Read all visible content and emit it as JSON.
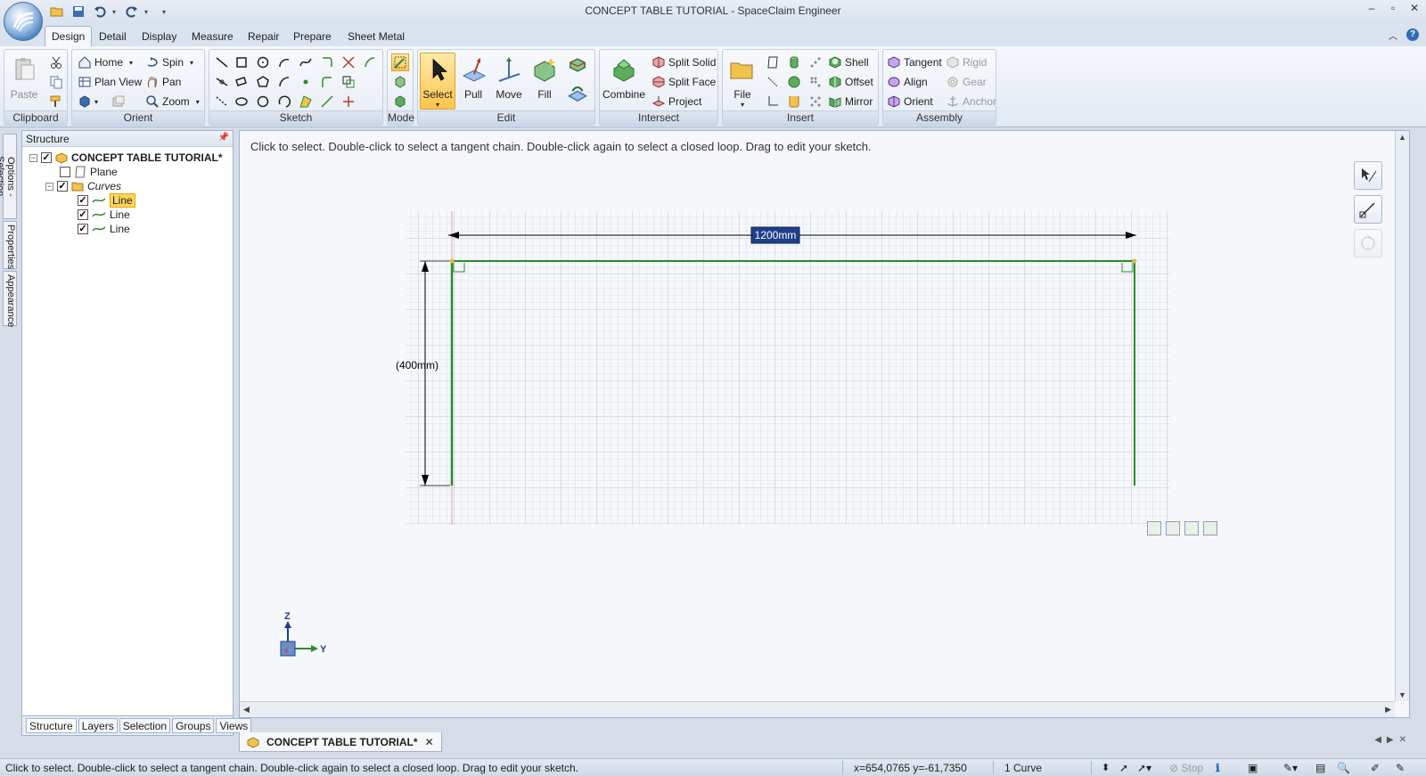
{
  "window": {
    "title": "CONCEPT TABLE TUTORIAL - SpaceClaim Engineer",
    "controls": [
      "minimize-icon",
      "maximize-icon",
      "close-icon"
    ]
  },
  "quick_access": [
    "open-icon",
    "save-icon",
    "undo-icon",
    "redo-icon",
    "customize-icon"
  ],
  "ribbon": {
    "tabs": [
      "Design",
      "Detail",
      "Display",
      "Measure",
      "Repair",
      "Prepare",
      "Sheet Metal"
    ],
    "active_tab": "Design",
    "groups": {
      "clipboard": {
        "label": "Clipboard",
        "paste": "Paste"
      },
      "orient": {
        "label": "Orient",
        "home": "Home",
        "spin": "Spin",
        "plan_view": "Plan View",
        "pan": "Pan",
        "zoom": "Zoom"
      },
      "sketch": {
        "label": "Sketch"
      },
      "mode": {
        "label": "Mode"
      },
      "edit": {
        "label": "Edit",
        "select": "Select",
        "pull": "Pull",
        "move": "Move",
        "fill": "Fill"
      },
      "intersect": {
        "label": "Intersect",
        "combine": "Combine",
        "split_solid": "Split Solid",
        "split_face": "Split Face",
        "project": "Project"
      },
      "insert": {
        "label": "Insert",
        "file": "File",
        "shell": "Shell",
        "offset": "Offset",
        "mirror": "Mirror"
      },
      "assembly": {
        "label": "Assembly",
        "tangent": "Tangent",
        "align": "Align",
        "orient": "Orient",
        "rigid": "Rigid",
        "gear": "Gear",
        "anchor": "Anchor"
      }
    }
  },
  "side_tabs": [
    "Options - Selection",
    "Properties",
    "Appearance"
  ],
  "structure": {
    "title": "Structure",
    "tree": {
      "root": "CONCEPT TABLE TUTORIAL*",
      "plane": "Plane",
      "curves": "Curves",
      "lines": [
        "Line",
        "Line",
        "Line"
      ]
    },
    "panel_tabs": [
      "Structure",
      "Layers",
      "Selection",
      "Groups",
      "Views"
    ]
  },
  "viewport": {
    "hint": "Click to select. Double-click to select a tangent chain. Double-click again to select a closed loop. Drag to edit your sketch.",
    "dimension_width": "1200mm",
    "dimension_height": "(400mm)",
    "axis_z": "Z",
    "axis_y": "Y",
    "sketch_color": "#2e8b2e"
  },
  "document_tab": "CONCEPT TABLE TUTORIAL*",
  "statusbar": {
    "message": "Click to select. Double-click to select a tangent chain. Double-click again to select a closed loop. Drag to edit your sketch.",
    "coordinates": "x=654,0765  y=-61,7350",
    "selection_count": "1 Curve",
    "stop": "Stop"
  },
  "colors": {
    "accent": "#ffc44e",
    "ribbon_bg": "#e2e9f3",
    "tree_highlight": "#ffd45c"
  }
}
